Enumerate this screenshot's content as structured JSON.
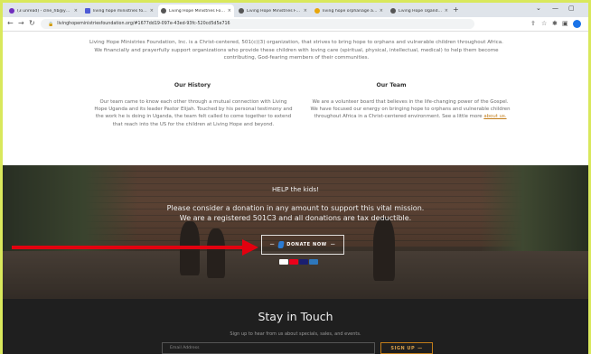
{
  "browser": {
    "tabs": [
      {
        "label": "(3 unread) - clne_hb@yahoo.co",
        "color": "#6f2dbd"
      },
      {
        "label": "living hope ministries foundati",
        "color": "#4e5bd6"
      },
      {
        "label": "Living Hope Ministries Foundati",
        "color": "#333333",
        "active": true
      },
      {
        "label": "Living Hope Ministries Foundati",
        "color": "#333333"
      },
      {
        "label": "living hope orphanage africa -",
        "color": "#e8a60b"
      },
      {
        "label": "Living Hope Uganda | Living Ho",
        "color": "#333333"
      }
    ],
    "new_tab": "+",
    "url": "livinghopeministriesfoundation.org/#1677dd19-097e-43ed-93fc-520cd5d5e716",
    "nav": {
      "back": "←",
      "forward": "→",
      "reload": "↻"
    },
    "window_controls": {
      "minimize": "⌄",
      "restore": "—",
      "maximize": "▢"
    }
  },
  "page": {
    "intro": "Living Hope Ministries Foundation, Inc. is a Christ-centered, 501(c)(3) organization, that strives to bring hope to orphans and vulnerable children throughout Africa.  We financially and prayerfully support organizations who provide these children with loving care (spiritual, physical, intellectual, medical) to help them become contributing, God-fearing members of their communities.",
    "history": {
      "title": "Our History",
      "text": "Our team came to know each other through a mutual connection with Living Hope Uganda and its leader Pastor Elijah.  Touched by his personal testimony and the work he is doing in Uganda, the team felt called to come together to extend that reach into the US for the children at Living Hope and beyond."
    },
    "team": {
      "title": "Our Team",
      "text": "We are a volunteer board that believes in the life-changing power of the Gospel.  We have focused our energy on bringing hope to orphans and vulnerable children throughout Africa in a Christ-centered environment.  See a little more ",
      "link": "about us."
    },
    "banner": {
      "headline": "HELP the kids!",
      "line1": "Please consider a donation in any amount to support this vital mission.",
      "line2": "We are a registered 501C3 and all donations are tax deductible.",
      "donate_label": "DONATE NOW",
      "card_colors": [
        "#ffffff",
        "#eb001b",
        "#1a1f71",
        "#2e77bc"
      ]
    },
    "newsletter": {
      "title": "Stay in Touch",
      "subtitle": "Sign up to hear from us about specials, sales, and events.",
      "email_placeholder": "Email Address",
      "button": "SIGN UP"
    }
  }
}
